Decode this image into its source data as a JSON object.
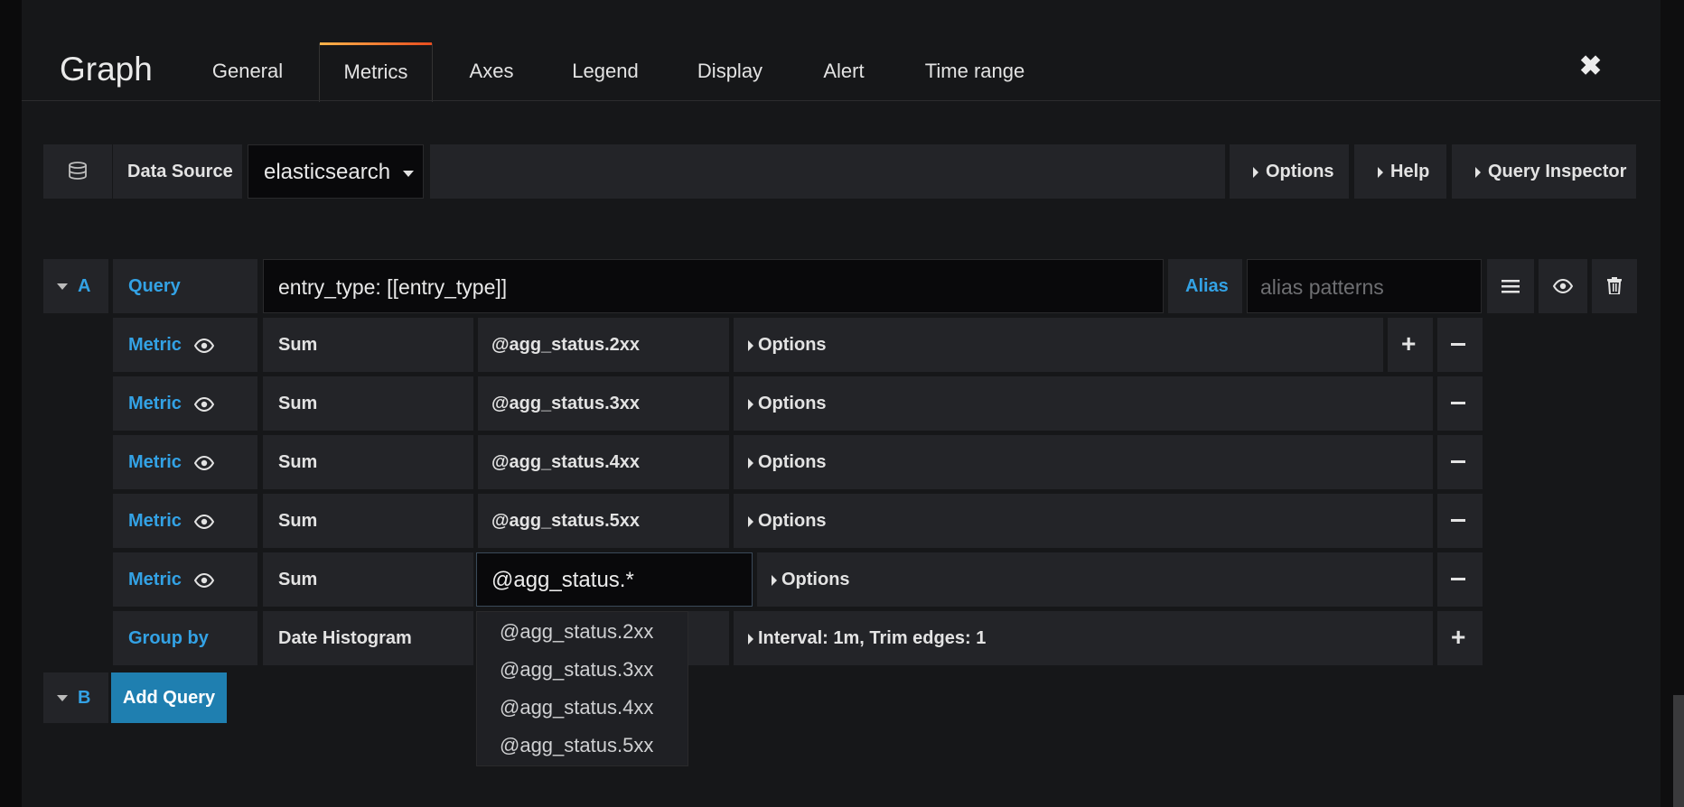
{
  "header": {
    "title": "Graph",
    "tabs": [
      "General",
      "Metrics",
      "Axes",
      "Legend",
      "Display",
      "Alert",
      "Time range"
    ],
    "active_tab": "Metrics"
  },
  "datasource": {
    "label": "Data Source",
    "value": "elasticsearch",
    "options_btn": "Options",
    "help_btn": "Help",
    "inspector_btn": "Query Inspector"
  },
  "query_a": {
    "ref": "A",
    "query_label": "Query",
    "query_value": "entry_type: [[entry_type]]",
    "alias_label": "Alias",
    "alias_placeholder": "alias patterns",
    "metric_label": "Metric",
    "metrics": [
      {
        "agg": "Sum",
        "field": "@agg_status.2xx",
        "options": "Options"
      },
      {
        "agg": "Sum",
        "field": "@agg_status.3xx",
        "options": "Options"
      },
      {
        "agg": "Sum",
        "field": "@agg_status.4xx",
        "options": "Options"
      },
      {
        "agg": "Sum",
        "field": "@agg_status.5xx",
        "options": "Options"
      },
      {
        "agg": "Sum",
        "field": "@agg_status.*",
        "options": "Options"
      }
    ],
    "group_by_label": "Group by",
    "group_by_type": "Date Histogram",
    "group_by_settings": "Interval: 1m, Trim edges: 1"
  },
  "field_suggestions": [
    "@agg_status.2xx",
    "@agg_status.3xx",
    "@agg_status.4xx",
    "@agg_status.5xx"
  ],
  "query_b": {
    "ref": "B",
    "add_query": "Add Query"
  }
}
